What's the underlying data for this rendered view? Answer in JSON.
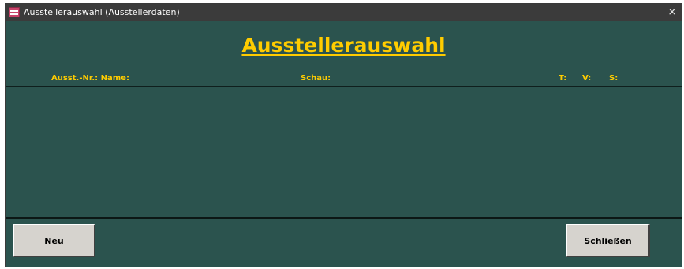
{
  "window": {
    "title": "Ausstellerauswahl (Ausstellerdaten)",
    "close_symbol": "×"
  },
  "form": {
    "heading": "Ausstellerauswahl"
  },
  "columns": {
    "nr_name": "Ausst.-Nr.: Name:",
    "schau": "Schau:",
    "t": "T:",
    "v": "V:",
    "s": "S:"
  },
  "list": {
    "rows": []
  },
  "buttons": {
    "neu": {
      "mnemonic": "N",
      "rest": "eu"
    },
    "schliessen": {
      "mnemonic": "S",
      "rest": "chließen"
    }
  },
  "colors": {
    "background": "#2b534e",
    "accent": "#ffcc00",
    "button_face": "#d6d3ce"
  },
  "icons": {
    "app": "access-form-icon",
    "close": "close-icon"
  }
}
